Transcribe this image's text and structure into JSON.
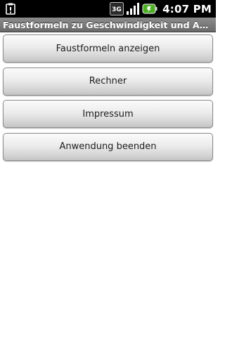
{
  "status_bar": {
    "time": "4:07 PM",
    "network_label": "3G",
    "icons": [
      "notification-icon",
      "network-3g-icon",
      "signal-icon",
      "battery-icon"
    ],
    "battery_color": "#4caf23"
  },
  "title_bar": {
    "title": "Faustformeln zu Geschwindigkeit und Abstand"
  },
  "menu": {
    "buttons": [
      {
        "label": "Faustformeln anzeigen"
      },
      {
        "label": "Rechner"
      },
      {
        "label": "Impressum"
      },
      {
        "label": "Anwendung beenden"
      }
    ]
  }
}
